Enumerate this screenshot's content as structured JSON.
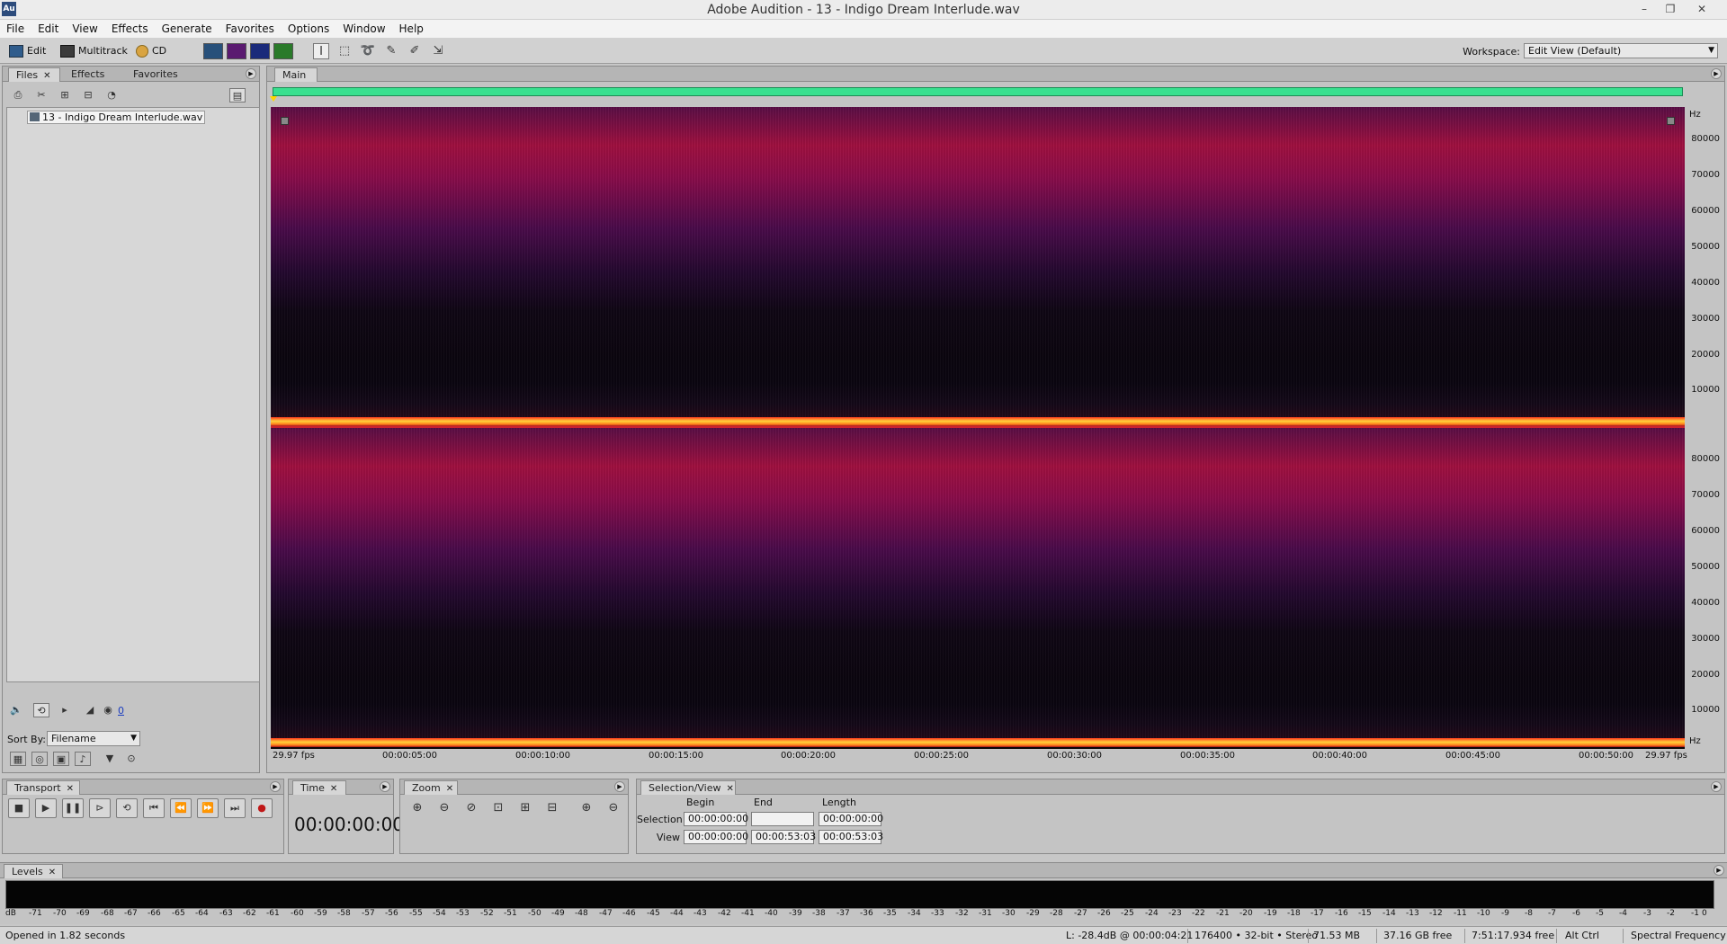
{
  "titlebar": {
    "app_icon": "Au",
    "title": "Adobe Audition - 13 - Indigo Dream Interlude.wav",
    "minimize": "–",
    "restore": "❐",
    "close": "✕"
  },
  "menubar": [
    "File",
    "Edit",
    "View",
    "Effects",
    "Generate",
    "Favorites",
    "Options",
    "Window",
    "Help"
  ],
  "toolbar": {
    "edit_label": "Edit",
    "multitrack_label": "Multitrack",
    "cd_label": "CD",
    "workspace_label": "Workspace:",
    "workspace_value": "Edit View (Default)"
  },
  "files_panel": {
    "tabs": [
      "Files",
      "Effects",
      "Favorites"
    ],
    "file_name": "13 - Indigo Dream Interlude.wav",
    "sort_by_label": "Sort By:",
    "sort_by_value": "Filename",
    "volume_value": "0"
  },
  "main_panel": {
    "tab": "Main"
  },
  "hz_axis": {
    "unit": "Hz",
    "top_channel_ticks": [
      "80000",
      "70000",
      "60000",
      "50000",
      "40000",
      "30000",
      "20000",
      "10000"
    ],
    "bottom_channel_ticks": [
      "80000",
      "70000",
      "60000",
      "50000",
      "40000",
      "30000",
      "20000",
      "10000"
    ]
  },
  "time_axis": {
    "left_label": "29.97 fps",
    "ticks": [
      "00:00:05:00",
      "00:00:10:00",
      "00:00:15:00",
      "00:00:20:00",
      "00:00:25:00",
      "00:00:30:00",
      "00:00:35:00",
      "00:00:40:00",
      "00:00:45:00",
      "00:00:50:00"
    ],
    "right_label": "29.97 fps"
  },
  "transport": {
    "tab": "Transport"
  },
  "time_panel": {
    "tab": "Time",
    "display": "00:00:00:00"
  },
  "zoom_panel": {
    "tab": "Zoom"
  },
  "selection_view": {
    "tab": "Selection/View",
    "col_begin": "Begin",
    "col_end": "End",
    "col_length": "Length",
    "row_selection": "Selection",
    "row_view": "View",
    "selection_begin": "00:00:00:00",
    "selection_end": "",
    "selection_length": "00:00:00:00",
    "view_begin": "00:00:00:00",
    "view_end": "00:00:53:03",
    "view_length": "00:00:53:03"
  },
  "levels": {
    "tab": "Levels",
    "scale": [
      "dB",
      "-71",
      "-70",
      "-69",
      "-68",
      "-67",
      "-66",
      "-65",
      "-64",
      "-63",
      "-62",
      "-61",
      "-60",
      "-59",
      "-58",
      "-57",
      "-56",
      "-55",
      "-54",
      "-53",
      "-52",
      "-51",
      "-50",
      "-49",
      "-48",
      "-47",
      "-46",
      "-45",
      "-44",
      "-43",
      "-42",
      "-41",
      "-40",
      "-39",
      "-38",
      "-37",
      "-36",
      "-35",
      "-34",
      "-33",
      "-32",
      "-31",
      "-30",
      "-29",
      "-28",
      "-27",
      "-26",
      "-25",
      "-24",
      "-23",
      "-22",
      "-21",
      "-20",
      "-19",
      "-18",
      "-17",
      "-16",
      "-15",
      "-14",
      "-13",
      "-12",
      "-11",
      "-10",
      "-9",
      "-8",
      "-7",
      "-6",
      "-5",
      "-4",
      "-3",
      "-2",
      "-1",
      "0"
    ]
  },
  "statusbar": {
    "opened": "Opened in 1.82 seconds",
    "level_readout": "L: -28.4dB @ 00:00:04:21",
    "format": "176400 • 32-bit • Stereo",
    "file_size": "71.53 MB",
    "disk_free": "37.16 GB free",
    "time_free": "7:51:17.934 free",
    "keys": "Alt Ctrl",
    "view_mode": "Spectral Frequency"
  },
  "colors": {
    "overview_bar": "#39e08f",
    "spectral_hot": "#ffd23a",
    "spectral_mid": "#a0103f"
  }
}
